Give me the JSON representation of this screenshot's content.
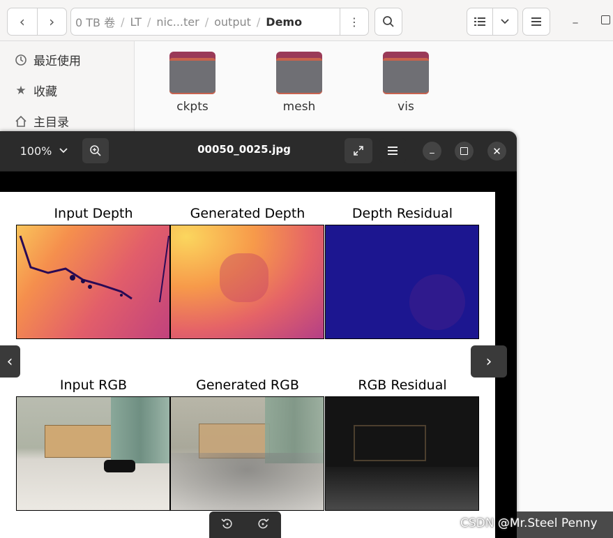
{
  "file_manager": {
    "path": [
      "0 TB 卷",
      "LT",
      "nic...ter",
      "output",
      "Demo"
    ],
    "sidebar": [
      {
        "label": "最近使用",
        "icon": "clock-icon"
      },
      {
        "label": "收藏",
        "icon": "star-icon"
      },
      {
        "label": "主目录",
        "icon": "home-icon"
      }
    ],
    "folders": [
      "ckpts",
      "mesh",
      "vis"
    ]
  },
  "viewer": {
    "zoom": "100%",
    "title": "00050_0025.jpg"
  },
  "figure": {
    "titles": [
      "Input Depth",
      "Generated Depth",
      "Depth Residual",
      "Input RGB",
      "Generated RGB",
      "RGB Residual"
    ]
  },
  "watermark": "CSDN @Mr.Steel Penny",
  "colors": {
    "folder_accent": "#9a3a58",
    "viewer_header": "#2b2b2b"
  }
}
